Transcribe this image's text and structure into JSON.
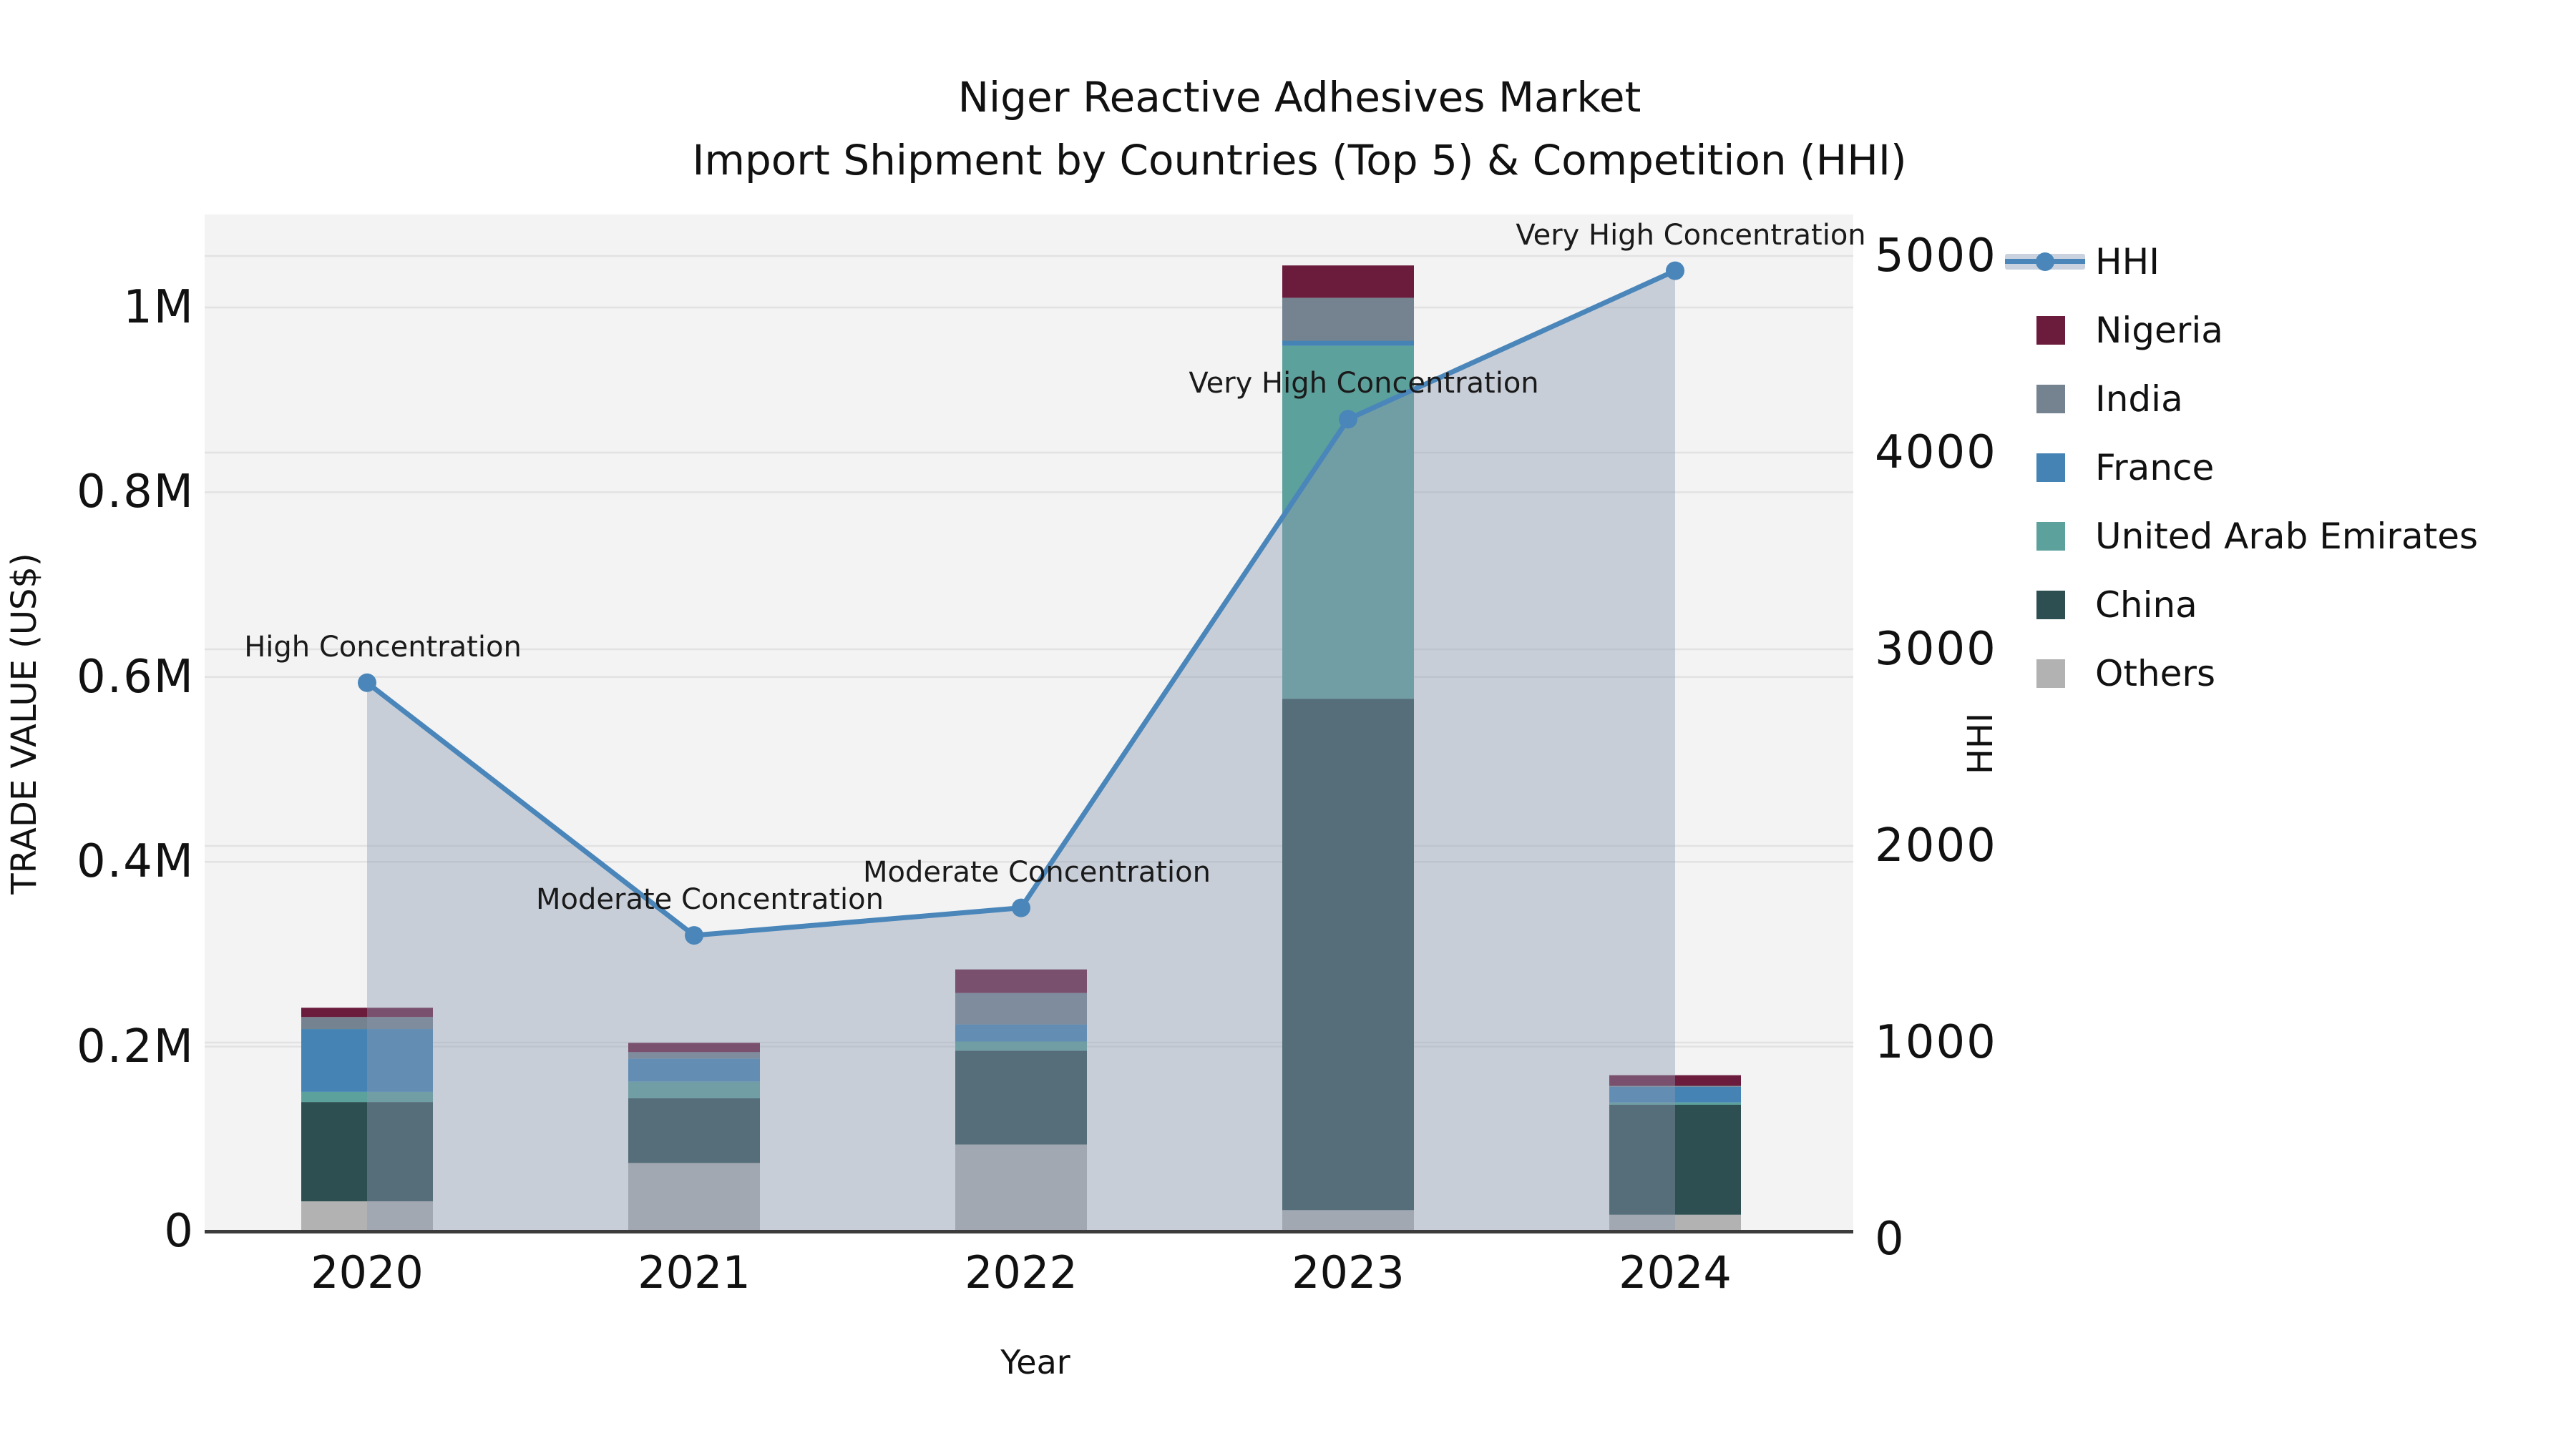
{
  "title": {
    "line1": "Niger Reactive Adhesives Market",
    "line2": "Import Shipment by Countries (Top 5) & Competition (HHI)"
  },
  "legend": {
    "items": [
      {
        "label": "HHI",
        "swatch": "line",
        "color": "#4a86ba",
        "band": "#c9d2de"
      },
      {
        "label": "Nigeria",
        "swatch": "square",
        "color": "#6b1b3c"
      },
      {
        "label": "India",
        "swatch": "square",
        "color": "#75828f"
      },
      {
        "label": "France",
        "swatch": "square",
        "color": "#4583b4"
      },
      {
        "label": "United Arab Emirates",
        "swatch": "square",
        "color": "#5da19c"
      },
      {
        "label": "China",
        "swatch": "square",
        "color": "#2e4f51"
      },
      {
        "label": "Others",
        "swatch": "square",
        "color": "#b2b2b2"
      }
    ]
  },
  "chart_data": {
    "type": "bar+line",
    "title": "Niger Reactive Adhesives Market — Import Shipment by Countries (Top 5) & Competition (HHI)",
    "categories": [
      "2020",
      "2021",
      "2022",
      "2023",
      "2024"
    ],
    "bar_series_stack_bottom_to_top": [
      {
        "name": "Others",
        "color": "#b2b2b2",
        "values": [
          32500,
          74000,
          94000,
          23000,
          18000
        ]
      },
      {
        "name": "China",
        "color": "#2e4f51",
        "values": [
          107500,
          70000,
          101500,
          553500,
          119000
        ]
      },
      {
        "name": "United Arab Emirates",
        "color": "#5da19c",
        "values": [
          11000,
          18000,
          10000,
          382000,
          2500
        ]
      },
      {
        "name": "France",
        "color": "#4583b4",
        "values": [
          68000,
          25000,
          18500,
          5500,
          17000
        ]
      },
      {
        "name": "India",
        "color": "#75828f",
        "values": [
          13000,
          7000,
          34000,
          46500,
          1000
        ]
      },
      {
        "name": "Nigeria",
        "color": "#6b1b3c",
        "values": [
          10000,
          10000,
          25500,
          35000,
          11500
        ]
      }
    ],
    "line_series": {
      "name": "HHI",
      "color": "#4a86ba",
      "area_fill": "rgba(141,155,178,0.42)",
      "values": [
        2830,
        1545,
        1685,
        4170,
        4925
      ]
    },
    "annotations": [
      "High Concentration",
      "Moderate Concentration",
      "Moderate Concentration",
      "Very High Concentration",
      "Very High Concentration"
    ],
    "y_left_axis": {
      "label": "TRADE VALUE (US$)",
      "tick_labels": [
        "0",
        "0.2M",
        "0.4M",
        "0.6M",
        "0.8M",
        "1M"
      ],
      "ticks": [
        0,
        200000,
        400000,
        600000,
        800000,
        1000000
      ],
      "range": [
        0,
        1100000
      ],
      "grid": true
    },
    "y_right_axis": {
      "label": "HHI",
      "tick_labels": [
        "0",
        "1000",
        "2000",
        "3000",
        "4000",
        "5000"
      ],
      "ticks": [
        0,
        1000,
        2000,
        3000,
        4000,
        5000
      ],
      "range": [
        0,
        5170
      ],
      "grid": true
    },
    "x_axis": {
      "label": "Year"
    },
    "plot_background": "#f3f3f3",
    "legend_position": "right-outside"
  }
}
